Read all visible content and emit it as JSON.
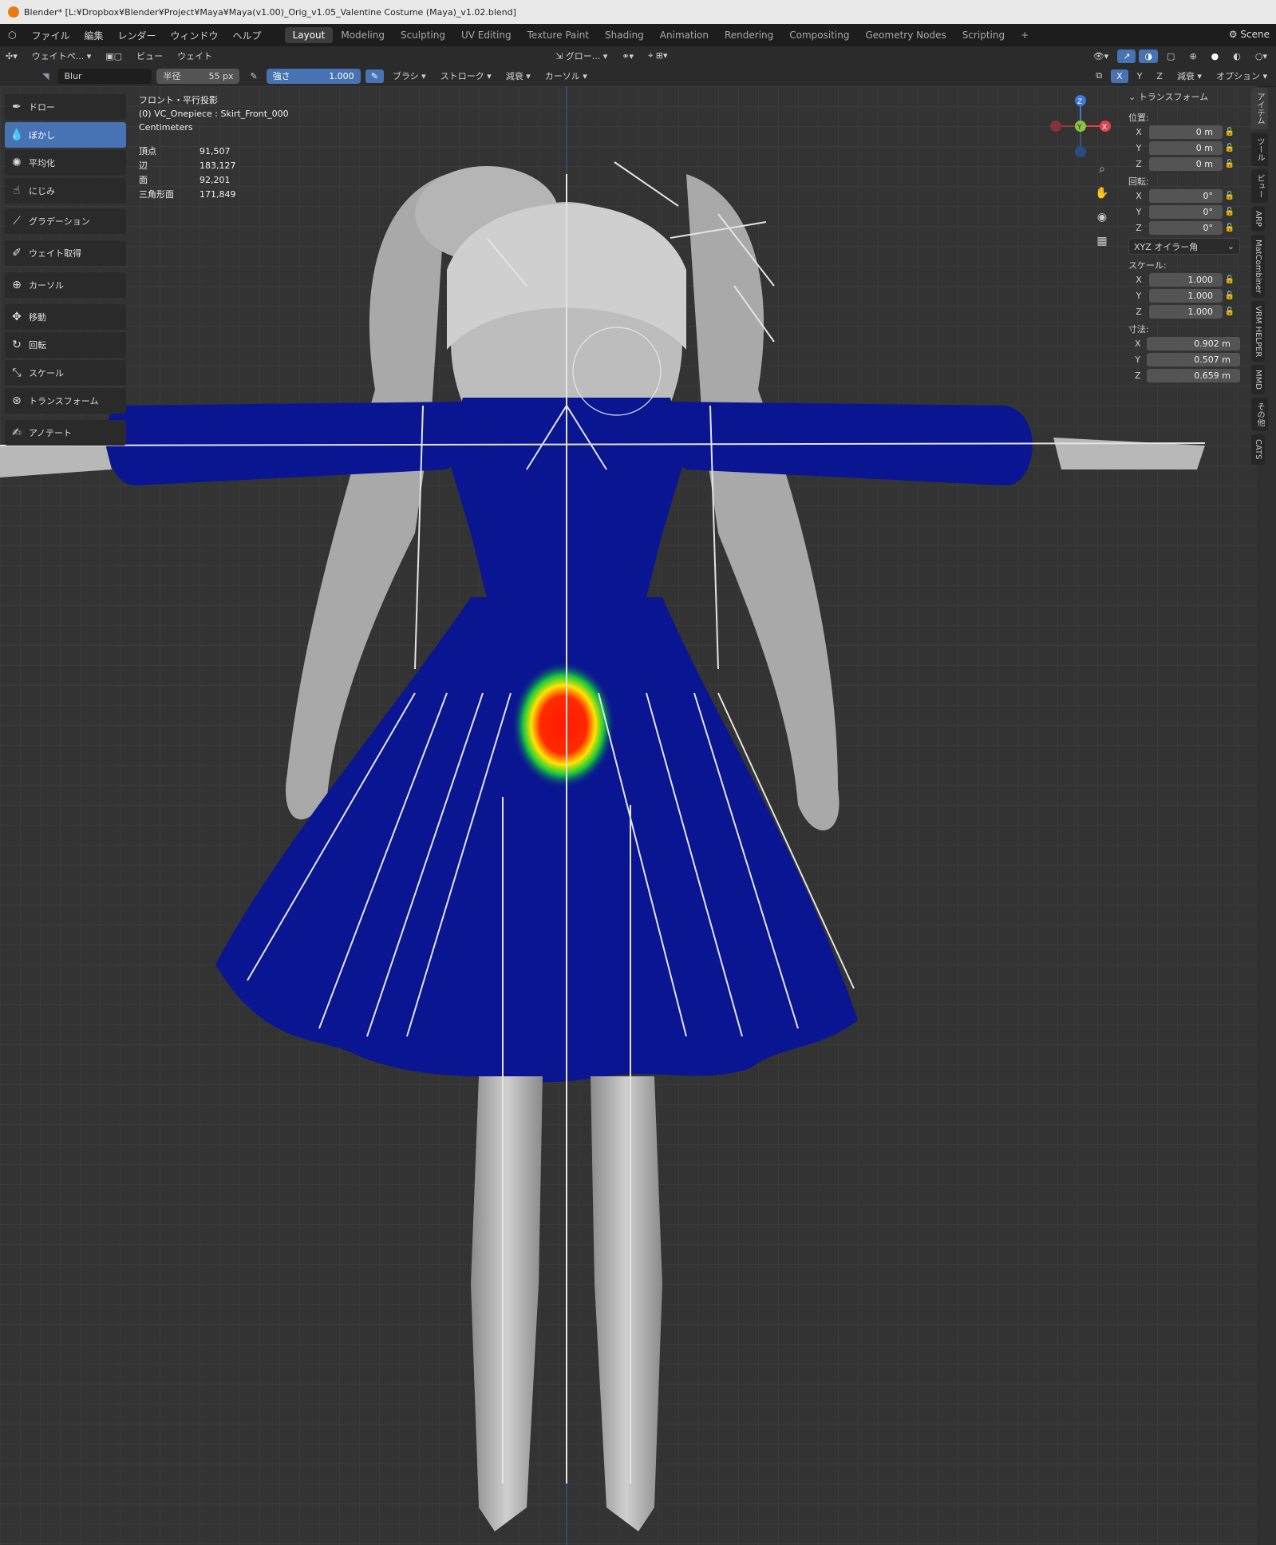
{
  "title": "Blender* [L:¥Dropbox¥Blender¥Project¥Maya¥Maya(v1.00)_Orig_v1.05_Valentine Costume (Maya)_v1.02.blend]",
  "menu": [
    "ファイル",
    "編集",
    "レンダー",
    "ウィンドウ",
    "ヘルプ"
  ],
  "workspaces": [
    "Layout",
    "Modeling",
    "Sculpting",
    "UV Editing",
    "Texture Paint",
    "Shading",
    "Animation",
    "Rendering",
    "Compositing",
    "Geometry Nodes",
    "Scripting"
  ],
  "active_workspace": "Layout",
  "scene_label": "Scene",
  "header1": {
    "mode": "ウェイトペ...",
    "view": "ビュー",
    "weights": "ウェイト",
    "transform_orient": "グロー..."
  },
  "header2": {
    "brush_name": "Blur",
    "radius_label": "半径",
    "radius_value": "55 px",
    "strength_label": "強さ",
    "strength_value": "1.000",
    "brush_menu": "ブラシ",
    "stroke_menu": "ストローク",
    "falloff_menu": "減衰",
    "cursor_menu": "カーソル",
    "mirror_x": "X",
    "mirror_y": "Y",
    "mirror_z": "Z",
    "right_falloff": "減衰",
    "options": "オプション"
  },
  "tools": [
    {
      "label": "ドロー",
      "icon": "brush-icon"
    },
    {
      "label": "ぼかし",
      "icon": "drop-icon",
      "active": true
    },
    {
      "label": "平均化",
      "icon": "average-icon"
    },
    {
      "label": "にじみ",
      "icon": "smear-icon"
    },
    {
      "label": "グラデーション",
      "icon": "gradient-icon"
    },
    {
      "label": "ウェイト取得",
      "icon": "eyedropper-icon"
    },
    {
      "label": "カーソル",
      "icon": "cursor-icon"
    },
    {
      "label": "移動",
      "icon": "move-icon"
    },
    {
      "label": "回転",
      "icon": "rotate-icon"
    },
    {
      "label": "スケール",
      "icon": "scale-icon"
    },
    {
      "label": "トランスフォーム",
      "icon": "transform-icon"
    },
    {
      "label": "アノテート",
      "icon": "annotate-icon"
    }
  ],
  "overlay": {
    "view": "フロント・平行投影",
    "object": "(0) VC_Onepiece : Skirt_Front_000",
    "units": "Centimeters"
  },
  "stats": [
    {
      "k": "頂点",
      "v": "91,507"
    },
    {
      "k": "辺",
      "v": "183,127"
    },
    {
      "k": "面",
      "v": "92,201"
    },
    {
      "k": "三角形面",
      "v": "171,849"
    }
  ],
  "npanel": {
    "header": "トランスフォーム",
    "location_label": "位置:",
    "location": [
      {
        "a": "X",
        "v": "0 m"
      },
      {
        "a": "Y",
        "v": "0 m"
      },
      {
        "a": "Z",
        "v": "0 m"
      }
    ],
    "rotation_label": "回転:",
    "rotation": [
      {
        "a": "X",
        "v": "0°"
      },
      {
        "a": "Y",
        "v": "0°"
      },
      {
        "a": "Z",
        "v": "0°"
      }
    ],
    "rotation_mode": "XYZ オイラー角",
    "scale_label": "スケール:",
    "scale": [
      {
        "a": "X",
        "v": "1.000"
      },
      {
        "a": "Y",
        "v": "1.000"
      },
      {
        "a": "Z",
        "v": "1.000"
      }
    ],
    "dimensions_label": "寸法:",
    "dimensions": [
      {
        "a": "X",
        "v": "0.902 m"
      },
      {
        "a": "Y",
        "v": "0.507 m"
      },
      {
        "a": "Z",
        "v": "0.659 m"
      }
    ]
  },
  "sidetabs": [
    "アイテム",
    "ツール",
    "ビュー",
    "ARP",
    "MatCombiner",
    "VRM HELPER",
    "MMD",
    "その他",
    "CATS"
  ],
  "gizmo_axes": {
    "z": "Z",
    "y": "Y",
    "x": "X"
  },
  "colors": {
    "accent": "#4772b3",
    "dress": "#0a1591",
    "heat_red": "#ff1a00",
    "heat_yellow": "#ffe400",
    "heat_green": "#16c93b"
  }
}
